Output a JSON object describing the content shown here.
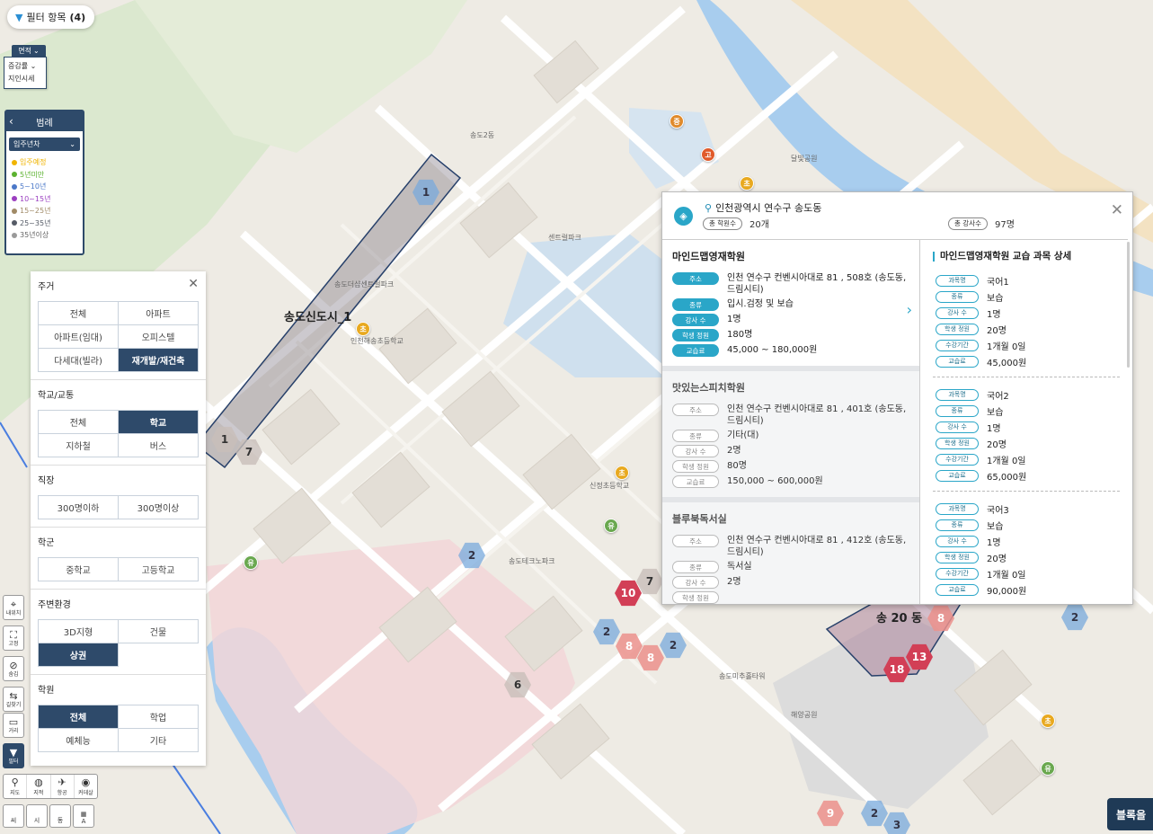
{
  "filter_button": {
    "label": "필터 항목",
    "count": "(4)"
  },
  "area_dropdown": {
    "label": "면적"
  },
  "price_type": {
    "line1": "증감률",
    "line2": "지인시세"
  },
  "legend": {
    "title": "범례",
    "select": "입주년차",
    "items": [
      {
        "label": "입주예정",
        "color": "#f0b400"
      },
      {
        "label": "5년미만",
        "color": "#5cb230"
      },
      {
        "label": "5~10년",
        "color": "#4b78c8"
      },
      {
        "label": "10~15년",
        "color": "#9b3fc0"
      },
      {
        "label": "15~25년",
        "color": "#a08a66"
      },
      {
        "label": "25~35년",
        "color": "#555b66"
      },
      {
        "label": "35년이상",
        "color": "#9a9a9a"
      }
    ]
  },
  "filter_panel": {
    "sections": [
      {
        "title": "주거",
        "buttons": [
          {
            "label": "전체",
            "on": false
          },
          {
            "label": "아파트",
            "on": false
          },
          {
            "label": "아파트(임대)",
            "on": false
          },
          {
            "label": "오피스텔",
            "on": false
          },
          {
            "label": "다세대(빌라)",
            "on": false
          },
          {
            "label": "재개발/재건축",
            "on": true
          }
        ]
      },
      {
        "title": "학교/교통",
        "buttons": [
          {
            "label": "전체",
            "on": false
          },
          {
            "label": "학교",
            "on": true
          },
          {
            "label": "지하철",
            "on": false
          },
          {
            "label": "버스",
            "on": false
          }
        ]
      },
      {
        "title": "직장",
        "buttons": [
          {
            "label": "300명이하",
            "on": false
          },
          {
            "label": "300명이상",
            "on": false
          }
        ]
      },
      {
        "title": "학군",
        "buttons": [
          {
            "label": "중학교",
            "on": false
          },
          {
            "label": "고등학교",
            "on": false
          }
        ]
      },
      {
        "title": "주변환경",
        "buttons": [
          {
            "label": "3D지형",
            "on": false
          },
          {
            "label": "건물",
            "on": false
          },
          {
            "label": "상권",
            "on": true
          }
        ]
      },
      {
        "title": "학원",
        "buttons": [
          {
            "label": "전체",
            "on": true
          },
          {
            "label": "학업",
            "on": false
          },
          {
            "label": "예체능",
            "on": false
          },
          {
            "label": "기타",
            "on": false
          }
        ]
      }
    ]
  },
  "toolbar": {
    "my_location": "내위치",
    "fix": "고정",
    "hide": "숨김",
    "find_route": "길찾기",
    "distance": "거리",
    "filter": "필터",
    "map_types": [
      "지도",
      "지적",
      "항공",
      "커데살"
    ],
    "levels": [
      "씨",
      "시",
      "동",
      "A"
    ]
  },
  "popup": {
    "address": "인천광역시 연수구 송도동",
    "academies_label": "총 학원수",
    "academies_value": "20개",
    "teachers_label": "총 강사수",
    "teachers_value": "97명",
    "academies": [
      {
        "name": "마인드맵영재학원",
        "rows": [
          {
            "k": "주소",
            "v": "인천 연수구 컨벤시아대로 81 , 508호 (송도동, 드림시티)"
          },
          {
            "k": "종류",
            "v": "입시.검정 및 보습"
          },
          {
            "k": "강사 수",
            "v": "1명"
          },
          {
            "k": "학생 정원",
            "v": "180명"
          },
          {
            "k": "교습료",
            "v": "45,000 ~ 180,000원"
          }
        ]
      },
      {
        "name": "맛있는스피치학원",
        "rows": [
          {
            "k": "주소",
            "v": "인천 연수구 컨벤시아대로 81 , 401호 (송도동, 드림시티)"
          },
          {
            "k": "종류",
            "v": "기타(대)"
          },
          {
            "k": "강사 수",
            "v": "2명"
          },
          {
            "k": "학생 정원",
            "v": "80명"
          },
          {
            "k": "교습료",
            "v": "150,000 ~ 600,000원"
          }
        ]
      },
      {
        "name": "블루북독서실",
        "rows": [
          {
            "k": "주소",
            "v": "인천 연수구 컨벤시아대로 81 , 412호 (송도동, 드림시티)"
          },
          {
            "k": "종류",
            "v": "독서실"
          },
          {
            "k": "강사 수",
            "v": "2명"
          },
          {
            "k": "학생 정원",
            "v": ""
          }
        ]
      }
    ],
    "detail_title": "마인드맵영재학원 교습 과목 상세",
    "courses": [
      {
        "rows": [
          {
            "k": "과목명",
            "v": "국어1"
          },
          {
            "k": "종류",
            "v": "보습"
          },
          {
            "k": "강사 수",
            "v": "1명"
          },
          {
            "k": "학생 정원",
            "v": "20명"
          },
          {
            "k": "수강기간",
            "v": "1개월 0일"
          },
          {
            "k": "교습료",
            "v": "45,000원"
          }
        ]
      },
      {
        "rows": [
          {
            "k": "과목명",
            "v": "국어2"
          },
          {
            "k": "종류",
            "v": "보습"
          },
          {
            "k": "강사 수",
            "v": "1명"
          },
          {
            "k": "학생 정원",
            "v": "20명"
          },
          {
            "k": "수강기간",
            "v": "1개월 0일"
          },
          {
            "k": "교습료",
            "v": "65,000원"
          }
        ]
      },
      {
        "rows": [
          {
            "k": "과목명",
            "v": "국어3"
          },
          {
            "k": "종류",
            "v": "보습"
          },
          {
            "k": "강사 수",
            "v": "1명"
          },
          {
            "k": "학생 정원",
            "v": "20명"
          },
          {
            "k": "수강기간",
            "v": "1개월 0일"
          },
          {
            "k": "교습료",
            "v": "90,000원"
          }
        ]
      }
    ]
  },
  "block_button": "블록을",
  "map": {
    "region_labels": [
      "송도신도시_1",
      "송 20 동"
    ],
    "place_labels": [
      "송도2동",
      "송도더샵센트럴파크",
      "해양공원",
      "달빛공원",
      "인천해송초등학교",
      "센트럴파크",
      "송도미추홀타워",
      "신정초등학교",
      "송도테크노파크"
    ],
    "clusters": [
      "1",
      "1",
      "7",
      "2",
      "10",
      "7",
      "2",
      "8",
      "8",
      "2",
      "6",
      "18",
      "13",
      "8",
      "2",
      "9",
      "2",
      "3"
    ],
    "poi_glyphs": {
      "elementary": "초",
      "high": "고",
      "kinder": "유",
      "middle": "중"
    }
  }
}
